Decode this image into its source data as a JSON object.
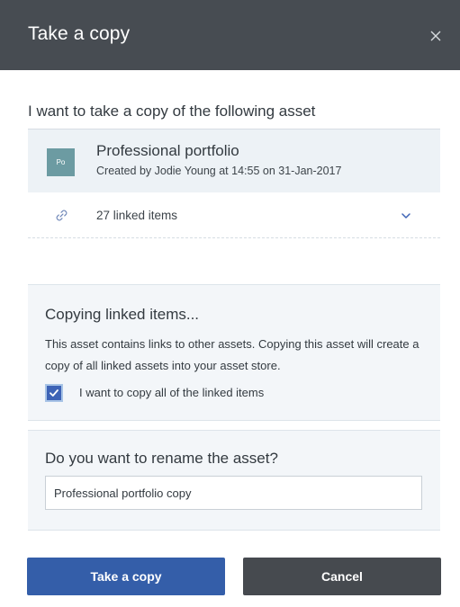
{
  "dialog": {
    "title": "Take a copy",
    "close_icon": "close-icon"
  },
  "intro_text": "I want to take a copy of the following asset",
  "asset": {
    "thumbnail_text": "Po",
    "thumbnail_color": "#6c9ba2",
    "name": "Professional portfolio",
    "meta": "Created by Jodie Young at 14:55 on 31-Jan-2017"
  },
  "linked": {
    "icon": "link-icon",
    "label": "27 linked items",
    "expand_icon": "chevron-down-icon"
  },
  "copy_linked": {
    "title": "Copying linked items...",
    "description": "This asset contains links to other assets. Copying this asset will create a copy of all linked assets into your asset store.",
    "checkbox_label": "I want to copy all of the linked items",
    "checked": true
  },
  "rename": {
    "title": "Do you want to rename the asset?",
    "value": "Professional portfolio copy"
  },
  "buttons": {
    "primary": "Take a copy",
    "secondary": "Cancel"
  },
  "colors": {
    "header_bg": "#474c52",
    "primary": "#345ea9",
    "secondary": "#464a4f",
    "panel_bg": "#f3f6f9"
  }
}
